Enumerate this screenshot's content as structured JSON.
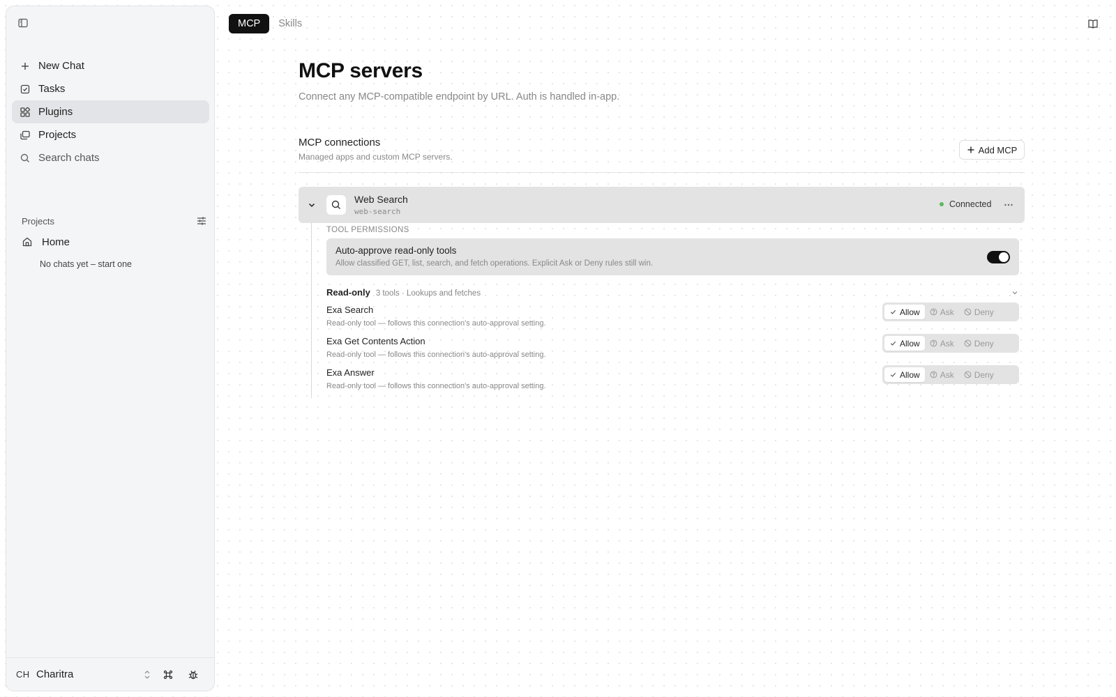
{
  "sidebar": {
    "nav": [
      {
        "label": "New Chat",
        "icon": "plus-icon"
      },
      {
        "label": "Tasks",
        "icon": "checkbox-icon"
      },
      {
        "label": "Plugins",
        "icon": "plugins-icon",
        "active": true
      },
      {
        "label": "Projects",
        "icon": "folders-icon"
      },
      {
        "label": "Search chats",
        "icon": "search-icon"
      }
    ],
    "projects_label": "Projects",
    "home_label": "Home",
    "no_chats": "No chats yet – start one",
    "user": {
      "initials": "CH",
      "name": "Charitra"
    }
  },
  "tabs": [
    {
      "label": "MCP",
      "active": true
    },
    {
      "label": "Skills",
      "active": false
    }
  ],
  "page": {
    "title": "MCP servers",
    "subtitle": "Connect any MCP-compatible endpoint by URL. Auth is handled in-app."
  },
  "connections": {
    "title": "MCP connections",
    "subtitle": "Managed apps and custom MCP servers.",
    "add_label": "Add MCP"
  },
  "server": {
    "name": "Web Search",
    "slug": "web-search",
    "status": "Connected",
    "status_color": "#5cb85c"
  },
  "permissions": {
    "label": "TOOL PERMISSIONS",
    "auto_title": "Auto-approve read-only tools",
    "auto_desc": "Allow classified GET, list, search, and fetch operations. Explicit Ask or Deny rules still win.",
    "auto_enabled": true
  },
  "group": {
    "name": "Read-only",
    "meta": "3 tools · Lookups and fetches"
  },
  "tools": [
    {
      "name": "Exa Search",
      "desc": "Read-only tool — follows this connection's auto-approval setting.",
      "selected": "Allow"
    },
    {
      "name": "Exa Get Contents Action",
      "desc": "Read-only tool — follows this connection's auto-approval setting.",
      "selected": "Allow"
    },
    {
      "name": "Exa Answer",
      "desc": "Read-only tool — follows this connection's auto-approval setting.",
      "selected": "Allow"
    }
  ],
  "options": {
    "allow": "Allow",
    "ask": "Ask",
    "deny": "Deny"
  }
}
